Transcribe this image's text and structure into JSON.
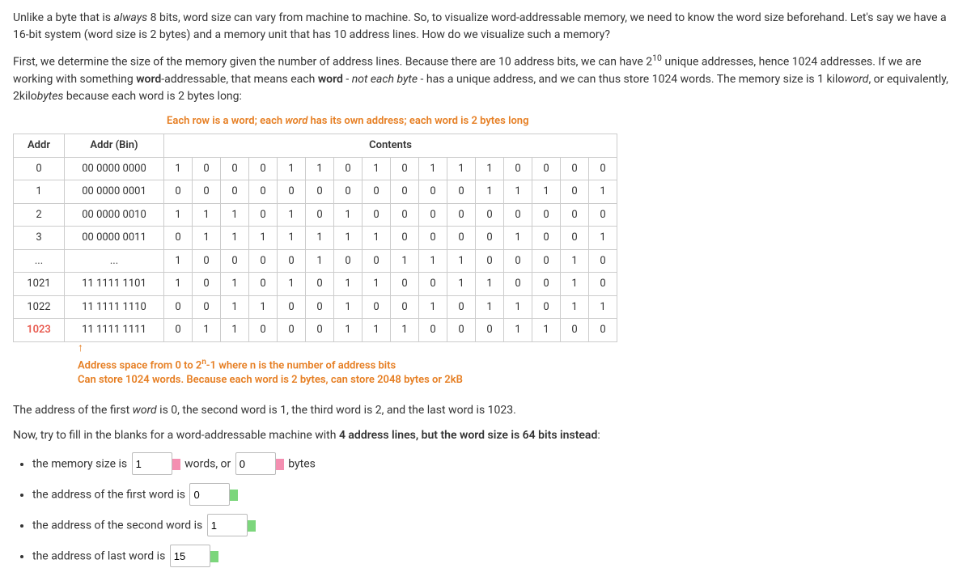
{
  "intro": {
    "p1a": "Unlike a byte that is ",
    "p1_em": "always",
    "p1b": " 8 bits, word size can vary from machine to machine. So, to visualize word-addressable memory, we need to know the word size beforehand. Let's say we have a 16-bit system (word size is 2 bytes) and a memory unit that has 10 address lines. How do we visualize such a memory?",
    "p2a": "First, we determine the size of the memory given the number of address lines. Because there are 10 address bits, we can have 2",
    "p2_sup": "10",
    "p2b": " unique addresses, hence 1024 addresses. If we are working with something ",
    "p2_bold1": "word",
    "p2c": "-addressable, that means each ",
    "p2_bold2": "word",
    "p2d": " - ",
    "p2_em": "not each byte",
    "p2e": " - has a unique address, and we can thus store 1024 words. The memory size is 1 kilo",
    "p2_em2": "word",
    "p2f": ", or equivalently, 2kilo",
    "p2_em3": "bytes",
    "p2g": " because each word is 2 bytes long:"
  },
  "diagram": {
    "caption_a": "Each row is a word;  each ",
    "caption_em": "word",
    "caption_b": " has its own address; each word is 2 bytes long",
    "th_addr": "Addr",
    "th_addrbin": "Addr (Bin)",
    "th_contents": "Contents",
    "rows": [
      {
        "addr": "0",
        "bin": "00 0000 0000",
        "bits": [
          "1",
          "0",
          "0",
          "0",
          "1",
          "1",
          "0",
          "1",
          "0",
          "1",
          "1",
          "1",
          "0",
          "0",
          "0",
          "0"
        ]
      },
      {
        "addr": "1",
        "bin": "00 0000 0001",
        "bits": [
          "0",
          "0",
          "0",
          "0",
          "0",
          "0",
          "0",
          "0",
          "0",
          "0",
          "0",
          "1",
          "1",
          "1",
          "0",
          "1"
        ]
      },
      {
        "addr": "2",
        "bin": "00 0000 0010",
        "bits": [
          "1",
          "1",
          "1",
          "0",
          "1",
          "0",
          "1",
          "0",
          "0",
          "0",
          "0",
          "0",
          "0",
          "0",
          "0",
          "0"
        ]
      },
      {
        "addr": "3",
        "bin": "00 0000 0011",
        "bits": [
          "0",
          "1",
          "1",
          "1",
          "1",
          "1",
          "1",
          "1",
          "0",
          "0",
          "0",
          "0",
          "1",
          "0",
          "0",
          "1"
        ]
      },
      {
        "addr": "...",
        "bin": "...",
        "bits": [
          "1",
          "0",
          "0",
          "0",
          "0",
          "1",
          "0",
          "0",
          "1",
          "1",
          "1",
          "0",
          "0",
          "0",
          "1",
          "0"
        ]
      },
      {
        "addr": "1021",
        "bin": "11 1111 1101",
        "bits": [
          "1",
          "0",
          "1",
          "0",
          "1",
          "0",
          "1",
          "1",
          "0",
          "0",
          "1",
          "1",
          "0",
          "0",
          "1",
          "0"
        ]
      },
      {
        "addr": "1022",
        "bin": "11 1111 1110",
        "bits": [
          "0",
          "0",
          "1",
          "1",
          "0",
          "0",
          "1",
          "0",
          "0",
          "1",
          "0",
          "1",
          "1",
          "0",
          "1",
          "1"
        ]
      },
      {
        "addr": "1023",
        "bin": "11 1111 1111",
        "bits": [
          "0",
          "1",
          "1",
          "0",
          "0",
          "0",
          "1",
          "1",
          "1",
          "0",
          "0",
          "0",
          "1",
          "1",
          "0",
          "0"
        ],
        "hl": true
      }
    ],
    "below1a": "Address space from 0 to 2",
    "below1sup": "n",
    "below1b": "-1 where n is the number of address bits",
    "below2": "Can store 1024 words. Because each word is 2 bytes, can store 2048 bytes or 2kB"
  },
  "after": {
    "p3a": "The address of the first ",
    "p3_em": "word",
    "p3b": " is 0, the second word is 1, the third word is 2, and the last word is 1023.",
    "p4a": "Now, try to fill in the blanks for a word-addressable machine with ",
    "p4_bold": "4 address lines, but the word size is 64 bits instead",
    "p4b": ":"
  },
  "blanks": {
    "li1a": "the memory size is ",
    "li1b": " words, or ",
    "li1c": " bytes",
    "li2": "the address of the first word is ",
    "li3": "the address of the second word is ",
    "li4": "the address of last word is ",
    "v1": "1",
    "v2": "0",
    "v3": "0",
    "v4": "1",
    "v5": "15"
  }
}
